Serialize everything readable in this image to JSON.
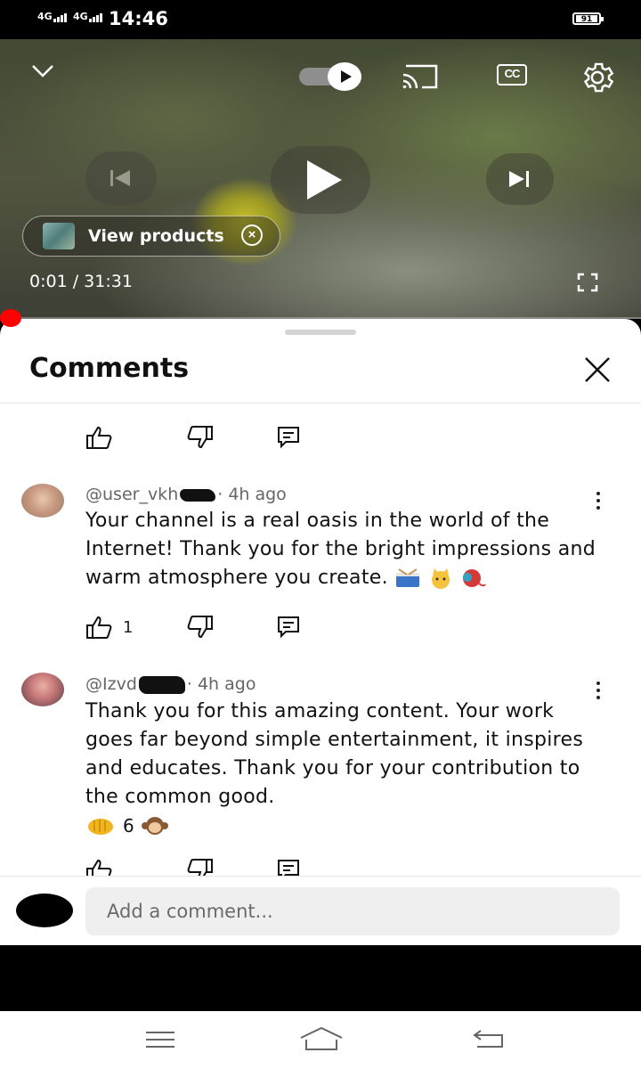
{
  "status_bar": {
    "network_1": "4G",
    "network_2": "4G",
    "time": "14:46",
    "battery": "91"
  },
  "player": {
    "view_products_label": "View products",
    "time_display": "0:01 / 31:31",
    "progress_fraction": 0.0005,
    "icons": [
      "chevron-down-icon",
      "autoplay-toggle",
      "cast-icon",
      "cc-icon",
      "settings-icon",
      "previous-icon",
      "play-icon",
      "next-icon",
      "fullscreen-icon"
    ],
    "cc_label": "CC"
  },
  "comments_panel": {
    "title": "Comments",
    "comments": [
      {
        "author": "@user_vkh",
        "time": "· 4h ago",
        "text": "Your channel is a real oasis in the world of the Internet! Thank you for the bright impressions and warm atmosphere you create.",
        "likes": "1"
      },
      {
        "author": "@Izvd",
        "time": "· 4h ago",
        "text": "Thank you for this amazing content. Your work goes far beyond simple entertainment, it inspires and educates. Thank you for your contribution to the common good.",
        "reaction_count": "6"
      }
    ]
  },
  "composer": {
    "placeholder": "Add a comment..."
  },
  "colors": {
    "progress": "#ff0000",
    "sheet_bg": "#ffffff",
    "input_bg": "#efefef"
  }
}
